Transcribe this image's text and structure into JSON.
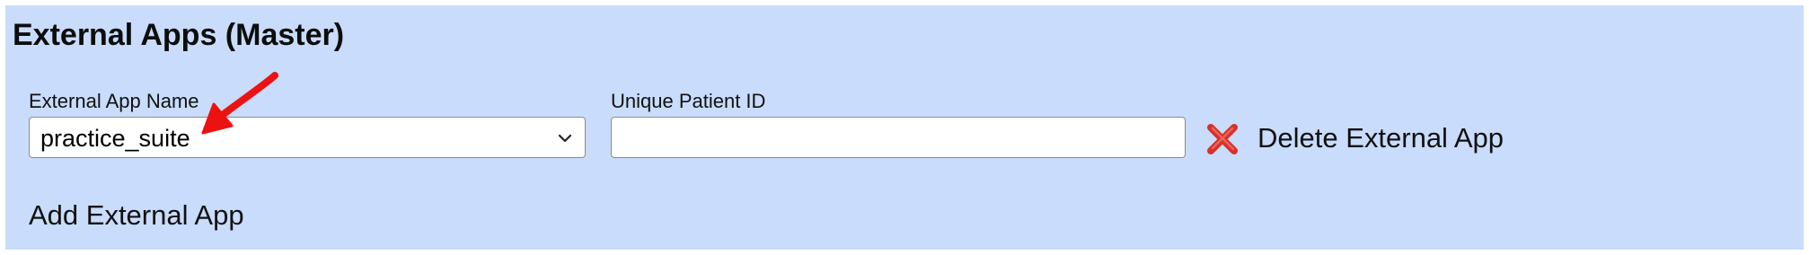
{
  "section": {
    "title": "External Apps (Master)"
  },
  "form": {
    "app_name_label": "External App Name",
    "app_name_value": "practice_suite",
    "patient_id_label": "Unique Patient ID",
    "patient_id_value": "",
    "delete_label": "Delete External App",
    "add_label": "Add External App"
  },
  "icons": {
    "delete": "close-x-icon",
    "dropdown": "chevron-down-icon",
    "annotation": "red-arrow-annotation"
  },
  "colors": {
    "panel_background": "#c9dcfb",
    "delete_icon": "#d8312b",
    "annotation_arrow": "#ee1111"
  }
}
